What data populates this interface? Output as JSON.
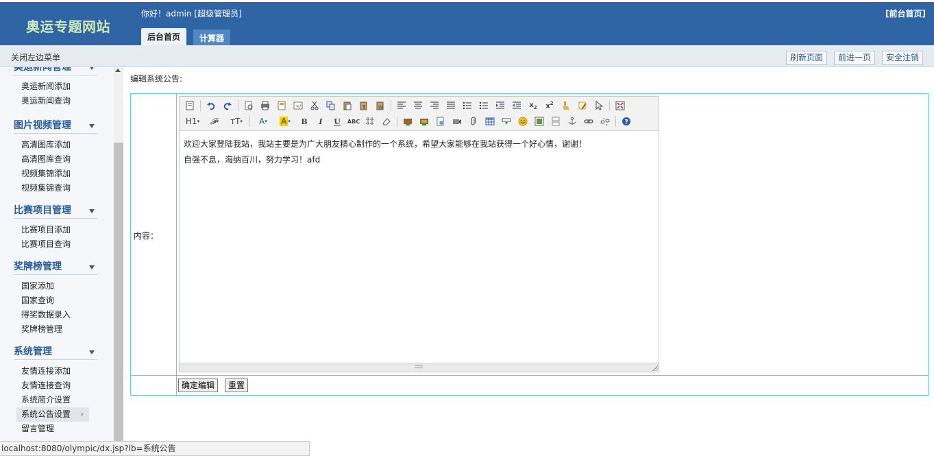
{
  "header": {
    "site_title": "奥运专题网站",
    "greeting": "你好！admin [超级管理员]",
    "tabs": [
      {
        "label": "后台首页"
      },
      {
        "label": "计算器"
      }
    ],
    "front_link": "[前台首页]"
  },
  "subbar": {
    "toggle_menu": "关闭左边菜单",
    "buttons": [
      {
        "label": "刷新页面"
      },
      {
        "label": "前进一页"
      },
      {
        "label": "安全注销"
      }
    ]
  },
  "sidebar": {
    "groups": [
      {
        "title": "奥运新闻管理",
        "items": [
          "奥运新闻添加",
          "奥运新闻查询"
        ]
      },
      {
        "title": "图片视频管理",
        "items": [
          "高清图库添加",
          "高清图库查询",
          "视频集锦添加",
          "视频集锦查询"
        ]
      },
      {
        "title": "比赛项目管理",
        "items": [
          "比赛项目添加",
          "比赛项目查询"
        ]
      },
      {
        "title": "奖牌榜管理",
        "items": [
          "国家添加",
          "国家查询",
          "得奖数据录入",
          "奖牌榜管理"
        ]
      },
      {
        "title": "系统管理",
        "items": [
          "友情连接添加",
          "友情连接查询",
          "系统简介设置",
          "系统公告设置",
          "留言管理"
        ]
      }
    ],
    "selected_item": "系统公告设置"
  },
  "main": {
    "title": "编辑系统公告:",
    "content_label": "内容：",
    "editor": {
      "line1": "欢迎大家登陆我站，我站主要是为广大朋友精心制作的一个系统，希望大家能够在我站获得一个好心情，谢谢！",
      "line2": "自强不息，海纳百川，努力学习！afd",
      "toolbar": {
        "heading": "H1",
        "font_family": "𝓕",
        "font_size": "тT",
        "font_color": "A",
        "bg_color": "A",
        "bold": "B",
        "italic": "I",
        "underline": "U",
        "strikethrough": "ABC"
      }
    },
    "submit_label": "确定编辑",
    "reset_label": "重置"
  },
  "statusbar": {
    "url": "localhost:8080/olympic/dx.jsp?lb=系统公告"
  }
}
